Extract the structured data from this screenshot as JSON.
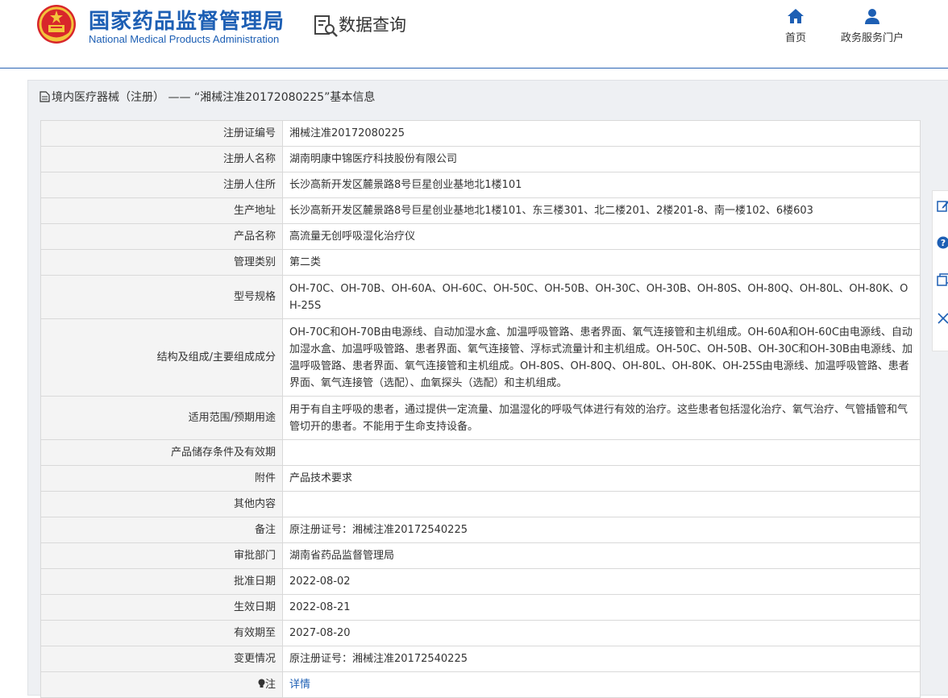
{
  "header": {
    "brand_cn": "国家药品监督管理局",
    "brand_en": "National Medical Products Administration",
    "query_title": "数据查询",
    "nav": [
      {
        "label": "首页",
        "icon": "home-icon"
      },
      {
        "label": "政务服务门户",
        "icon": "user-icon"
      }
    ],
    "colors": {
      "brand": "#1d5fb4",
      "border": "#2b64b5"
    }
  },
  "panel": {
    "title": "境内医疗器械（注册） —— “湘械注准20172080225”基本信息"
  },
  "rows": [
    {
      "label": "注册证编号",
      "value": "湘械注准20172080225"
    },
    {
      "label": "注册人名称",
      "value": "湖南明康中锦医疗科技股份有限公司"
    },
    {
      "label": "注册人住所",
      "value": "长沙高新开发区麓景路8号巨星创业基地北1楼101"
    },
    {
      "label": "生产地址",
      "value": "长沙高新开发区麓景路8号巨星创业基地北1楼101、东三楼301、北二楼201、2楼201-8、南一楼102、6楼603"
    },
    {
      "label": "产品名称",
      "value": "高流量无创呼吸湿化治疗仪"
    },
    {
      "label": "管理类别",
      "value": "第二类"
    },
    {
      "label": "型号规格",
      "value": "OH-70C、OH-70B、OH-60A、OH-60C、OH-50C、OH-50B、OH-30C、OH-30B、OH-80S、OH-80Q、OH-80L、OH-80K、OH-25S"
    },
    {
      "label": "结构及组成/主要组成成分",
      "value": "OH-70C和OH-70B由电源线、自动加湿水盒、加温呼吸管路、患者界面、氧气连接管和主机组成。OH-60A和OH-60C由电源线、自动加湿水盒、加温呼吸管路、患者界面、氧气连接管、浮标式流量计和主机组成。OH-50C、OH-50B、OH-30C和OH-30B由电源线、加温呼吸管路、患者界面、氧气连接管和主机组成。OH-80S、OH-80Q、OH-80L、OH-80K、OH-25S由电源线、加温呼吸管路、患者界面、氧气连接管（选配）、血氧探头（选配）和主机组成。"
    },
    {
      "label": "适用范围/预期用途",
      "value": "用于有自主呼吸的患者，通过提供一定流量、加温湿化的呼吸气体进行有效的治疗。这些患者包括湿化治疗、氧气治疗、气管插管和气管切开的患者。不能用于生命支持设备。"
    },
    {
      "label": "产品储存条件及有效期",
      "value": ""
    },
    {
      "label": "附件",
      "value": "产品技术要求"
    },
    {
      "label": "其他内容",
      "value": ""
    },
    {
      "label": "备注",
      "value": "原注册证号：湘械注准20172540225"
    },
    {
      "label": "审批部门",
      "value": "湖南省药品监督管理局"
    },
    {
      "label": "批准日期",
      "value": "2022-08-02"
    },
    {
      "label": "生效日期",
      "value": "2022-08-21"
    },
    {
      "label": "有效期至",
      "value": "2027-08-20"
    },
    {
      "label": "变更情况",
      "value": "原注册证号：湘械注准20172540225"
    }
  ],
  "note_row": {
    "label": "注",
    "link": "详情"
  }
}
